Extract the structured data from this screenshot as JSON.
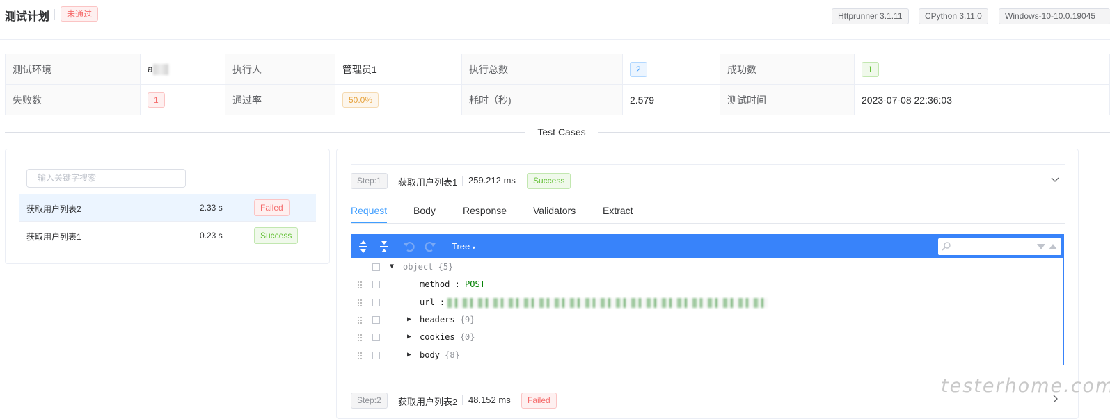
{
  "header": {
    "title": "测试计划",
    "status": "未通过",
    "env_tags": [
      "Httprunner 3.1.11",
      "CPython 3.11.0",
      "Windows-10-10.0.19045"
    ]
  },
  "info": {
    "row1": [
      {
        "label": "测试环境",
        "value": "a"
      },
      {
        "label": "执行人",
        "value": "管理员1"
      },
      {
        "label": "执行总数",
        "value": "2"
      },
      {
        "label": "成功数",
        "value": "1"
      }
    ],
    "row2": [
      {
        "label": "失败数",
        "value": "1"
      },
      {
        "label": "通过率",
        "value": "50.0%"
      },
      {
        "label": "耗时（秒)",
        "value": "2.579"
      },
      {
        "label": "测试时间",
        "value": "2023-07-08 22:36:03"
      }
    ]
  },
  "divider_label": "Test Cases",
  "search": {
    "placeholder": "输入关键字搜索"
  },
  "cases": [
    {
      "name": "获取用户列表2",
      "time": "2.33 s",
      "status": "Failed"
    },
    {
      "name": "获取用户列表1",
      "time": "0.23 s",
      "status": "Success"
    }
  ],
  "steps": [
    {
      "tag": "Step:1",
      "name": "获取用户列表1",
      "ms": "259.212 ms",
      "status": "Success"
    },
    {
      "tag": "Step:2",
      "name": "获取用户列表2",
      "ms": "48.152 ms",
      "status": "Failed"
    }
  ],
  "tabs": [
    "Request",
    "Body",
    "Response",
    "Validators",
    "Extract"
  ],
  "json_editor": {
    "mode": "Tree",
    "root_key": "object",
    "root_meta": "{5}",
    "method_key": "method",
    "method_value": "POST",
    "url_key": "url",
    "url_value": "https://.../users/a...in/...ch?...",
    "headers_key": "headers",
    "headers_meta": "{9}",
    "cookies_key": "cookies",
    "cookies_meta": "{0}",
    "body_key": "body",
    "body_meta": "{8}"
  },
  "watermark": "testerhome.com",
  "colors": {
    "accent": "#409eff",
    "editor": "#3883fa",
    "success": "#67c23a",
    "danger": "#f56c6c"
  }
}
